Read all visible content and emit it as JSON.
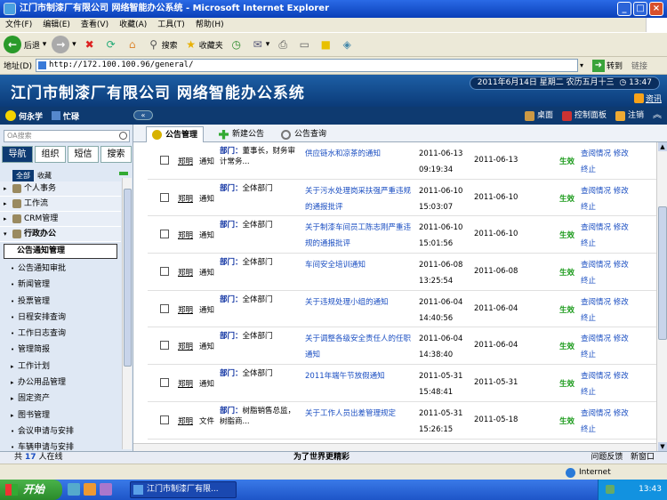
{
  "window": {
    "title": "江门市制漆厂有限公司 网络智能办公系统 - Microsoft Internet Explorer"
  },
  "menu": [
    "文件(F)",
    "编辑(E)",
    "查看(V)",
    "收藏(A)",
    "工具(T)",
    "帮助(H)"
  ],
  "toolbar": {
    "back": "后退",
    "search": "搜索",
    "favorites": "收藏夹"
  },
  "address": {
    "label": "地址(D)",
    "url": "http://172.100.100.96/general/",
    "go": "转到",
    "links": "链接"
  },
  "header": {
    "title": "江门市制漆厂有限公司 网络智能办公系统",
    "date": "2011年6月14日 星期二 农历五月十三",
    "time": "13:47",
    "promo": "资讯"
  },
  "userbar": {
    "user": "何永学",
    "status": "忙碌",
    "desktop": "桌面",
    "control": "控制面板",
    "logout": "注销"
  },
  "sidebar": {
    "search_placeholder": "OA搜索",
    "tabs": [
      "导航",
      "组织",
      "短信",
      "搜索"
    ],
    "subtabs": [
      "全部",
      "收藏"
    ],
    "groups": [
      "个人事务",
      "工作流",
      "CRM管理",
      "行政办公"
    ],
    "selected": "公告通知管理",
    "items": [
      "公告通知审批",
      "新闻管理",
      "投票管理",
      "日程安排查询",
      "工作日志查询",
      "管理简报",
      "工作计划",
      "办公用品管理",
      "固定资产",
      "图书管理",
      "会议申请与安排",
      "车辆申请与安排"
    ]
  },
  "main": {
    "tabs": [
      "公告管理",
      "新建公告",
      "公告查询"
    ],
    "rows": [
      {
        "sender": "郑明",
        "type": "通知",
        "dept_label": "部门：",
        "dept": "董事长，财务审计常务...",
        "subject": "供应链水和凉茶的通知",
        "pub_date": "2011-06-13",
        "pub_time": "09:19:34",
        "eff_date": "2011-06-13",
        "status": "生效",
        "ops": "查阅情况 修改 终止"
      },
      {
        "sender": "郑明",
        "type": "通知",
        "dept_label": "部门：",
        "dept": "全体部门",
        "subject": "关于污水处理岗采扶强严重违规的通报批评",
        "pub_date": "2011-06-10",
        "pub_time": "15:03:07",
        "eff_date": "2011-06-10",
        "status": "生效",
        "ops": "查阅情况 修改 终止"
      },
      {
        "sender": "郑明",
        "type": "通知",
        "dept_label": "部门：",
        "dept": "全体部门",
        "subject": "关于制漆车间员工陈志刚严重违规的通报批评",
        "pub_date": "2011-06-10",
        "pub_time": "15:01:56",
        "eff_date": "2011-06-10",
        "status": "生效",
        "ops": "查阅情况 修改 终止"
      },
      {
        "sender": "郑明",
        "type": "通知",
        "dept_label": "部门：",
        "dept": "全体部门",
        "subject": "车间安全培训通知",
        "pub_date": "2011-06-08",
        "pub_time": "13:25:54",
        "eff_date": "2011-06-08",
        "status": "生效",
        "ops": "查阅情况 修改 终止"
      },
      {
        "sender": "郑明",
        "type": "通知",
        "dept_label": "部门：",
        "dept": "全体部门",
        "subject": "关于违规处理小组的通知",
        "pub_date": "2011-06-04",
        "pub_time": "14:40:56",
        "eff_date": "2011-06-04",
        "status": "生效",
        "ops": "查阅情况 修改 终止"
      },
      {
        "sender": "郑明",
        "type": "通知",
        "dept_label": "部门：",
        "dept": "全体部门",
        "subject": "关于调整各级安全责任人的任职通知",
        "pub_date": "2011-06-04",
        "pub_time": "14:38:40",
        "eff_date": "2011-06-04",
        "status": "生效",
        "ops": "查阅情况 修改 终止"
      },
      {
        "sender": "郑明",
        "type": "通知",
        "dept_label": "部门：",
        "dept": "全体部门",
        "subject": "2011年端午节放假通知",
        "pub_date": "2011-05-31",
        "pub_time": "15:48:41",
        "eff_date": "2011-05-31",
        "status": "生效",
        "ops": "查阅情况 修改 终止"
      },
      {
        "sender": "郑明",
        "type": "文件",
        "dept_label": "部门：",
        "dept": "树脂销售总监，树脂商...",
        "subject": "关于工作人员出差管理规定",
        "pub_date": "2011-05-31",
        "pub_time": "15:26:15",
        "eff_date": "2011-05-18",
        "status": "生效",
        "ops": "查阅情况 修改 终止"
      }
    ]
  },
  "statusbar": {
    "online_prefix": "共",
    "online_count": "17",
    "online_suffix": "人在线",
    "slogan": "为了世界更精彩",
    "feedback": "问题反馈",
    "newwin": "新窗口"
  },
  "ie_status": {
    "zone": "Internet"
  },
  "taskbar": {
    "start": "开始",
    "task": "江门市制漆厂有限...",
    "clock": "13:43"
  }
}
